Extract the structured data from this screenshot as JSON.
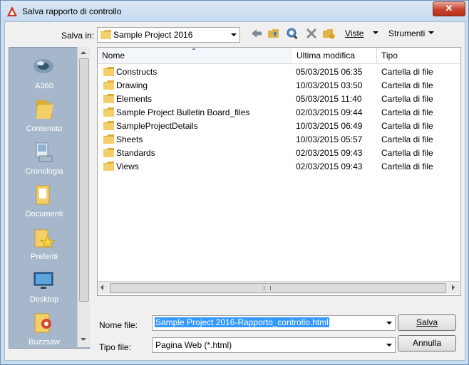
{
  "window": {
    "title": "Salva rapporto di controllo",
    "close_label": "✕"
  },
  "toolbar": {
    "save_in_label": "Salva in:",
    "location": "Sample Project 2016",
    "views_label": "Viste",
    "tools_label": "Strumenti"
  },
  "places": [
    {
      "label": "A360",
      "icon": "a360-icon"
    },
    {
      "label": "Contenuto",
      "icon": "content-folder-icon"
    },
    {
      "label": "Cronologia",
      "icon": "history-icon"
    },
    {
      "label": "Documenti",
      "icon": "documents-icon"
    },
    {
      "label": "Preferiti",
      "icon": "favorites-icon"
    },
    {
      "label": "Desktop",
      "icon": "desktop-icon"
    },
    {
      "label": "Buzzsaw",
      "icon": "buzzsaw-icon"
    }
  ],
  "columns": {
    "name": "Nome",
    "modified": "Ultima modifica",
    "type": "Tipo"
  },
  "files": [
    {
      "name": "Constructs",
      "modified": "05/03/2015 06:35",
      "type": "Cartella di file"
    },
    {
      "name": "Drawing",
      "modified": "10/03/2015 03:50",
      "type": "Cartella di file"
    },
    {
      "name": "Elements",
      "modified": "05/03/2015 11:40",
      "type": "Cartella di file"
    },
    {
      "name": "Sample Project Bulletin Board_files",
      "modified": "02/03/2015 09:44",
      "type": "Cartella di file"
    },
    {
      "name": "SampleProjectDetails",
      "modified": "10/03/2015 06:49",
      "type": "Cartella di file"
    },
    {
      "name": "Sheets",
      "modified": "10/03/2015 05:57",
      "type": "Cartella di file"
    },
    {
      "name": "Standards",
      "modified": "02/03/2015 09:43",
      "type": "Cartella di file"
    },
    {
      "name": "Views",
      "modified": "02/03/2015 09:43",
      "type": "Cartella di file"
    }
  ],
  "filename": {
    "label": "Nome file:",
    "value": "Sample Project 2016-Rapporto_controllo.html"
  },
  "filetype": {
    "label": "Tipo file:",
    "value": "Pagina Web (*.html)"
  },
  "buttons": {
    "save": "Salva",
    "cancel": "Annulla"
  },
  "colors": {
    "selection": "#3399ff",
    "places_bg": "#a6b7cb",
    "close": "#c7412c"
  }
}
